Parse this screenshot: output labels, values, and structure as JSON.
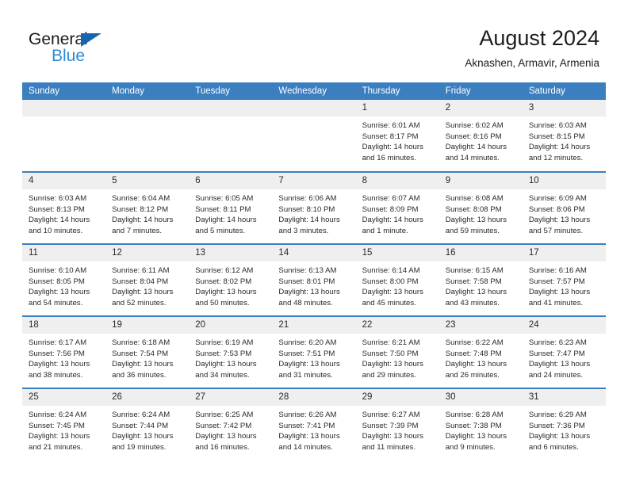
{
  "brand": {
    "name_part1": "General",
    "name_part2": "Blue",
    "triangle_color": "#1565b0",
    "blue_color": "#2e8ad4"
  },
  "header": {
    "title": "August 2024",
    "subtitle": "Aknashen, Armavir, Armenia"
  },
  "theme": {
    "header_row_bg": "#3c7fc0",
    "header_row_text": "#ffffff",
    "daynum_bg": "#efefef",
    "cell_bg": "#ffffff",
    "week_divider": "#3c7fc0",
    "body_text": "#2a2a2a"
  },
  "calendar": {
    "weekday_headers": [
      "Sunday",
      "Monday",
      "Tuesday",
      "Wednesday",
      "Thursday",
      "Friday",
      "Saturday"
    ],
    "weeks": [
      [
        {
          "day": "",
          "blank": true
        },
        {
          "day": "",
          "blank": true
        },
        {
          "day": "",
          "blank": true
        },
        {
          "day": "",
          "blank": true
        },
        {
          "day": "1",
          "sunrise": "Sunrise: 6:01 AM",
          "sunset": "Sunset: 8:17 PM",
          "daylight1": "Daylight: 14 hours",
          "daylight2": "and 16 minutes."
        },
        {
          "day": "2",
          "sunrise": "Sunrise: 6:02 AM",
          "sunset": "Sunset: 8:16 PM",
          "daylight1": "Daylight: 14 hours",
          "daylight2": "and 14 minutes."
        },
        {
          "day": "3",
          "sunrise": "Sunrise: 6:03 AM",
          "sunset": "Sunset: 8:15 PM",
          "daylight1": "Daylight: 14 hours",
          "daylight2": "and 12 minutes."
        }
      ],
      [
        {
          "day": "4",
          "sunrise": "Sunrise: 6:03 AM",
          "sunset": "Sunset: 8:13 PM",
          "daylight1": "Daylight: 14 hours",
          "daylight2": "and 10 minutes."
        },
        {
          "day": "5",
          "sunrise": "Sunrise: 6:04 AM",
          "sunset": "Sunset: 8:12 PM",
          "daylight1": "Daylight: 14 hours",
          "daylight2": "and 7 minutes."
        },
        {
          "day": "6",
          "sunrise": "Sunrise: 6:05 AM",
          "sunset": "Sunset: 8:11 PM",
          "daylight1": "Daylight: 14 hours",
          "daylight2": "and 5 minutes."
        },
        {
          "day": "7",
          "sunrise": "Sunrise: 6:06 AM",
          "sunset": "Sunset: 8:10 PM",
          "daylight1": "Daylight: 14 hours",
          "daylight2": "and 3 minutes."
        },
        {
          "day": "8",
          "sunrise": "Sunrise: 6:07 AM",
          "sunset": "Sunset: 8:09 PM",
          "daylight1": "Daylight: 14 hours",
          "daylight2": "and 1 minute."
        },
        {
          "day": "9",
          "sunrise": "Sunrise: 6:08 AM",
          "sunset": "Sunset: 8:08 PM",
          "daylight1": "Daylight: 13 hours",
          "daylight2": "and 59 minutes."
        },
        {
          "day": "10",
          "sunrise": "Sunrise: 6:09 AM",
          "sunset": "Sunset: 8:06 PM",
          "daylight1": "Daylight: 13 hours",
          "daylight2": "and 57 minutes."
        }
      ],
      [
        {
          "day": "11",
          "sunrise": "Sunrise: 6:10 AM",
          "sunset": "Sunset: 8:05 PM",
          "daylight1": "Daylight: 13 hours",
          "daylight2": "and 54 minutes."
        },
        {
          "day": "12",
          "sunrise": "Sunrise: 6:11 AM",
          "sunset": "Sunset: 8:04 PM",
          "daylight1": "Daylight: 13 hours",
          "daylight2": "and 52 minutes."
        },
        {
          "day": "13",
          "sunrise": "Sunrise: 6:12 AM",
          "sunset": "Sunset: 8:02 PM",
          "daylight1": "Daylight: 13 hours",
          "daylight2": "and 50 minutes."
        },
        {
          "day": "14",
          "sunrise": "Sunrise: 6:13 AM",
          "sunset": "Sunset: 8:01 PM",
          "daylight1": "Daylight: 13 hours",
          "daylight2": "and 48 minutes."
        },
        {
          "day": "15",
          "sunrise": "Sunrise: 6:14 AM",
          "sunset": "Sunset: 8:00 PM",
          "daylight1": "Daylight: 13 hours",
          "daylight2": "and 45 minutes."
        },
        {
          "day": "16",
          "sunrise": "Sunrise: 6:15 AM",
          "sunset": "Sunset: 7:58 PM",
          "daylight1": "Daylight: 13 hours",
          "daylight2": "and 43 minutes."
        },
        {
          "day": "17",
          "sunrise": "Sunrise: 6:16 AM",
          "sunset": "Sunset: 7:57 PM",
          "daylight1": "Daylight: 13 hours",
          "daylight2": "and 41 minutes."
        }
      ],
      [
        {
          "day": "18",
          "sunrise": "Sunrise: 6:17 AM",
          "sunset": "Sunset: 7:56 PM",
          "daylight1": "Daylight: 13 hours",
          "daylight2": "and 38 minutes."
        },
        {
          "day": "19",
          "sunrise": "Sunrise: 6:18 AM",
          "sunset": "Sunset: 7:54 PM",
          "daylight1": "Daylight: 13 hours",
          "daylight2": "and 36 minutes."
        },
        {
          "day": "20",
          "sunrise": "Sunrise: 6:19 AM",
          "sunset": "Sunset: 7:53 PM",
          "daylight1": "Daylight: 13 hours",
          "daylight2": "and 34 minutes."
        },
        {
          "day": "21",
          "sunrise": "Sunrise: 6:20 AM",
          "sunset": "Sunset: 7:51 PM",
          "daylight1": "Daylight: 13 hours",
          "daylight2": "and 31 minutes."
        },
        {
          "day": "22",
          "sunrise": "Sunrise: 6:21 AM",
          "sunset": "Sunset: 7:50 PM",
          "daylight1": "Daylight: 13 hours",
          "daylight2": "and 29 minutes."
        },
        {
          "day": "23",
          "sunrise": "Sunrise: 6:22 AM",
          "sunset": "Sunset: 7:48 PM",
          "daylight1": "Daylight: 13 hours",
          "daylight2": "and 26 minutes."
        },
        {
          "day": "24",
          "sunrise": "Sunrise: 6:23 AM",
          "sunset": "Sunset: 7:47 PM",
          "daylight1": "Daylight: 13 hours",
          "daylight2": "and 24 minutes."
        }
      ],
      [
        {
          "day": "25",
          "sunrise": "Sunrise: 6:24 AM",
          "sunset": "Sunset: 7:45 PM",
          "daylight1": "Daylight: 13 hours",
          "daylight2": "and 21 minutes."
        },
        {
          "day": "26",
          "sunrise": "Sunrise: 6:24 AM",
          "sunset": "Sunset: 7:44 PM",
          "daylight1": "Daylight: 13 hours",
          "daylight2": "and 19 minutes."
        },
        {
          "day": "27",
          "sunrise": "Sunrise: 6:25 AM",
          "sunset": "Sunset: 7:42 PM",
          "daylight1": "Daylight: 13 hours",
          "daylight2": "and 16 minutes."
        },
        {
          "day": "28",
          "sunrise": "Sunrise: 6:26 AM",
          "sunset": "Sunset: 7:41 PM",
          "daylight1": "Daylight: 13 hours",
          "daylight2": "and 14 minutes."
        },
        {
          "day": "29",
          "sunrise": "Sunrise: 6:27 AM",
          "sunset": "Sunset: 7:39 PM",
          "daylight1": "Daylight: 13 hours",
          "daylight2": "and 11 minutes."
        },
        {
          "day": "30",
          "sunrise": "Sunrise: 6:28 AM",
          "sunset": "Sunset: 7:38 PM",
          "daylight1": "Daylight: 13 hours",
          "daylight2": "and 9 minutes."
        },
        {
          "day": "31",
          "sunrise": "Sunrise: 6:29 AM",
          "sunset": "Sunset: 7:36 PM",
          "daylight1": "Daylight: 13 hours",
          "daylight2": "and 6 minutes."
        }
      ]
    ]
  }
}
